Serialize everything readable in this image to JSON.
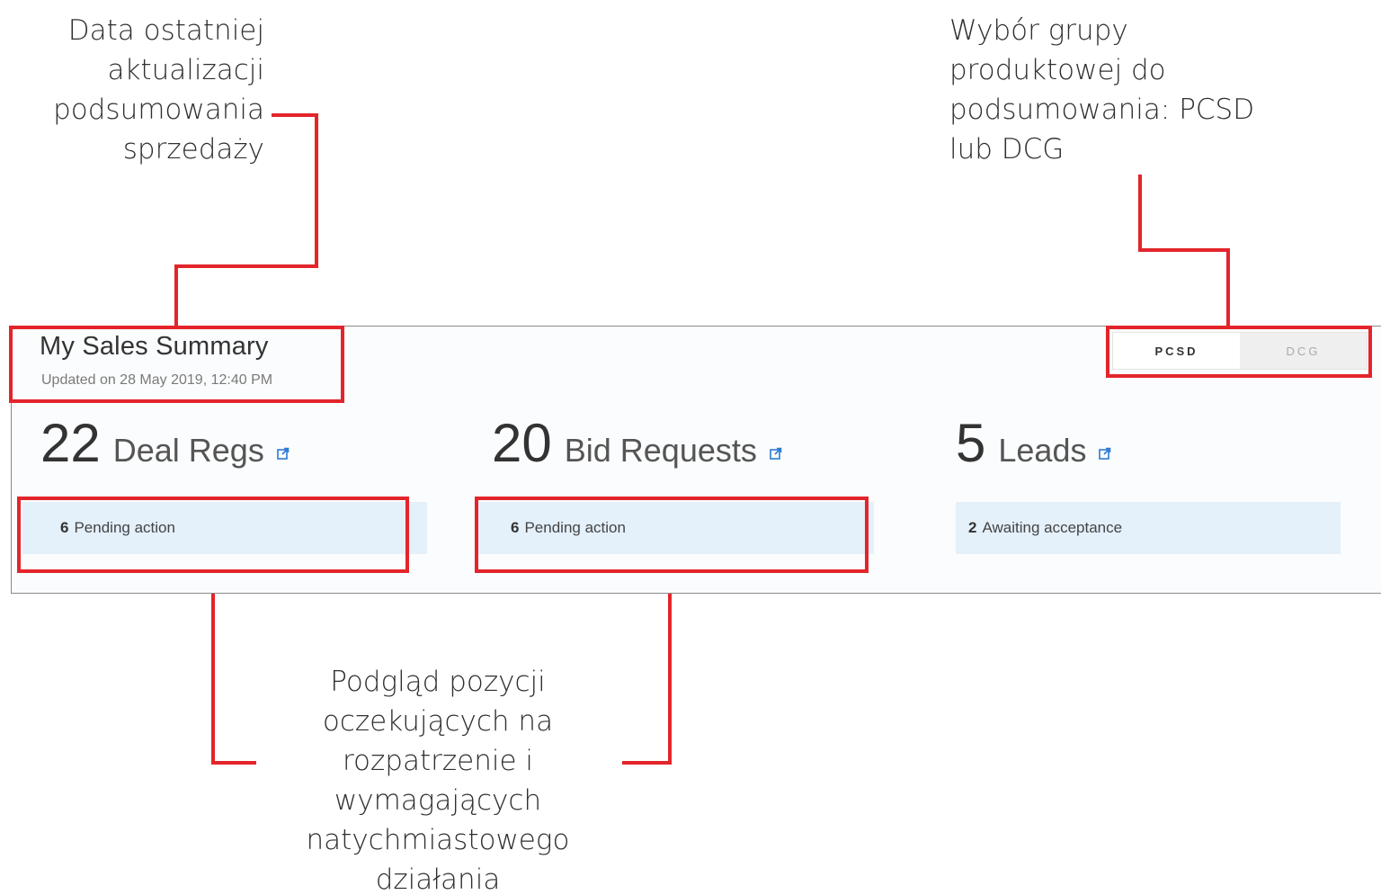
{
  "annotations": {
    "last_update": [
      "Data  ostatniej",
      "aktualizacji",
      "podsumowania",
      "sprzedaży"
    ],
    "group_select": [
      "Wybór grupy",
      "produktowej do",
      "podsumowania: PCSD",
      "lub DCG"
    ],
    "pending_preview": [
      "Podgląd pozycji",
      "oczekujących na",
      "rozpatrzenie i",
      "wymagających",
      "natychmiastowego",
      "działania"
    ]
  },
  "panel": {
    "title": "My Sales Summary",
    "updated": "Updated on 28 May 2019, 12:40 PM",
    "toggle": {
      "options": [
        "PCSD",
        "DCG"
      ],
      "selected": "PCSD"
    },
    "metrics": [
      {
        "count": "22",
        "label": "Deal Regs",
        "pending_count": "6",
        "pending_text": "Pending action"
      },
      {
        "count": "20",
        "label": "Bid Requests",
        "pending_count": "6",
        "pending_text": "Pending action"
      },
      {
        "count": "5",
        "label": "Leads",
        "pending_count": "2",
        "pending_text": "Awaiting acceptance"
      }
    ]
  },
  "colors": {
    "highlight": "#e3252b",
    "pending_bg": "#e4f0fa",
    "icon": "#2b7bd4"
  },
  "icons": {
    "external_link": "external-link-icon"
  }
}
